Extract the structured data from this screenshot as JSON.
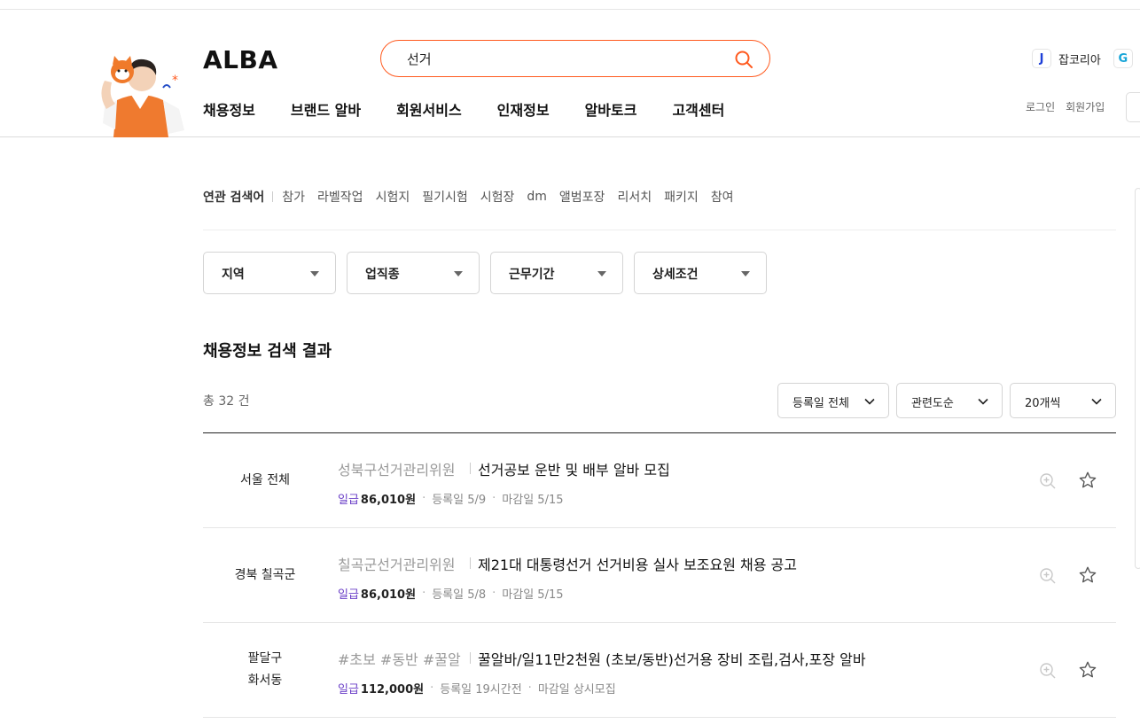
{
  "header": {
    "logo": "ALBA",
    "search": {
      "value": "선거",
      "placeholder": ""
    },
    "nav": [
      "채용정보",
      "브랜드 알바",
      "회원서비스",
      "인재정보",
      "알바토크",
      "고객센터"
    ],
    "family_sites": [
      {
        "badge": "J",
        "label": "잡코리아"
      },
      {
        "badge": "G",
        "label": ""
      }
    ],
    "util": {
      "login": "로그인",
      "signup": "회원가입"
    }
  },
  "related": {
    "title": "연관 검색어",
    "keywords": [
      "참가",
      "라벨작업",
      "시험지",
      "필기시험",
      "시험장",
      "dm",
      "앨범포장",
      "리서치",
      "패키지",
      "참여"
    ]
  },
  "filters": [
    "지역",
    "업직종",
    "근무기간",
    "상세조건"
  ],
  "results": {
    "title": "채용정보 검색 결과",
    "total": "총 32 건",
    "sort": {
      "date": "등록일 전체",
      "order": "관련도순",
      "per_page": "20개씩"
    },
    "rows": [
      {
        "loc": [
          "서울 전체"
        ],
        "company": "성북구선거관리위원",
        "title": "선거공보 운반 및 배부 알바 모집",
        "pay_type": "일급",
        "pay": "86,010원",
        "registered": "등록일 5/9",
        "deadline": "마감일 5/15"
      },
      {
        "loc": [
          "경북 칠곡군"
        ],
        "company": "칠곡군선거관리위원",
        "title": "제21대 대통령선거 선거비용 실사 보조요원 채용 공고",
        "pay_type": "일급",
        "pay": "86,010원",
        "registered": "등록일 5/8",
        "deadline": "마감일 5/15"
      },
      {
        "loc": [
          "팔달구",
          "화서동"
        ],
        "company": "#초보 #동반 #꿀알",
        "title": "꿀알바/일11만2천원 (초보/동반)선거용 장비 조립,검사,포장 알바",
        "pay_type": "일급",
        "pay": "112,000원",
        "registered": "등록일 19시간전",
        "deadline": "마감일 상시모집"
      }
    ]
  },
  "colors": {
    "accent": "#ff5a1f",
    "pay_type": "#6b3fc7"
  }
}
